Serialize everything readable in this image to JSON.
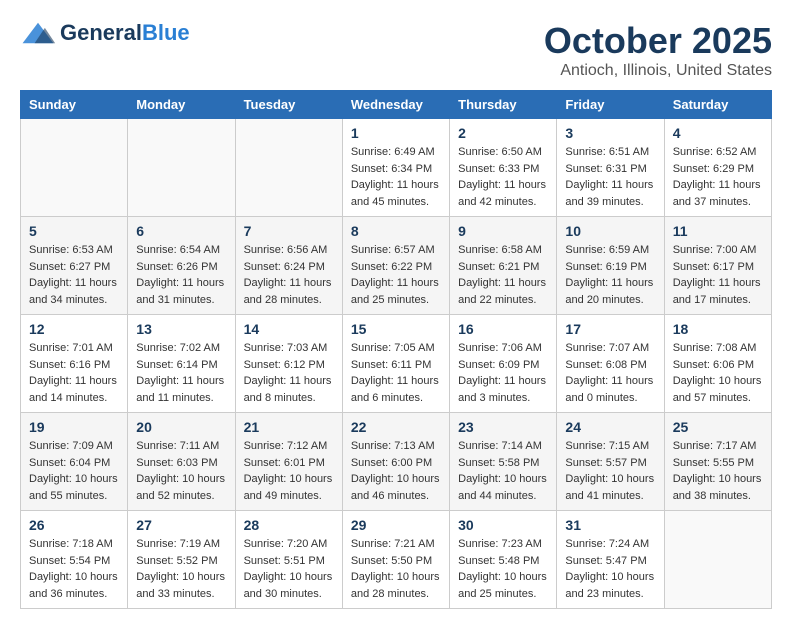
{
  "header": {
    "logo_general": "General",
    "logo_blue": "Blue",
    "month_title": "October 2025",
    "location": "Antioch, Illinois, United States"
  },
  "days_of_week": [
    "Sunday",
    "Monday",
    "Tuesday",
    "Wednesday",
    "Thursday",
    "Friday",
    "Saturday"
  ],
  "weeks": [
    [
      {
        "day": "",
        "info": ""
      },
      {
        "day": "",
        "info": ""
      },
      {
        "day": "",
        "info": ""
      },
      {
        "day": "1",
        "info": "Sunrise: 6:49 AM\nSunset: 6:34 PM\nDaylight: 11 hours\nand 45 minutes."
      },
      {
        "day": "2",
        "info": "Sunrise: 6:50 AM\nSunset: 6:33 PM\nDaylight: 11 hours\nand 42 minutes."
      },
      {
        "day": "3",
        "info": "Sunrise: 6:51 AM\nSunset: 6:31 PM\nDaylight: 11 hours\nand 39 minutes."
      },
      {
        "day": "4",
        "info": "Sunrise: 6:52 AM\nSunset: 6:29 PM\nDaylight: 11 hours\nand 37 minutes."
      }
    ],
    [
      {
        "day": "5",
        "info": "Sunrise: 6:53 AM\nSunset: 6:27 PM\nDaylight: 11 hours\nand 34 minutes."
      },
      {
        "day": "6",
        "info": "Sunrise: 6:54 AM\nSunset: 6:26 PM\nDaylight: 11 hours\nand 31 minutes."
      },
      {
        "day": "7",
        "info": "Sunrise: 6:56 AM\nSunset: 6:24 PM\nDaylight: 11 hours\nand 28 minutes."
      },
      {
        "day": "8",
        "info": "Sunrise: 6:57 AM\nSunset: 6:22 PM\nDaylight: 11 hours\nand 25 minutes."
      },
      {
        "day": "9",
        "info": "Sunrise: 6:58 AM\nSunset: 6:21 PM\nDaylight: 11 hours\nand 22 minutes."
      },
      {
        "day": "10",
        "info": "Sunrise: 6:59 AM\nSunset: 6:19 PM\nDaylight: 11 hours\nand 20 minutes."
      },
      {
        "day": "11",
        "info": "Sunrise: 7:00 AM\nSunset: 6:17 PM\nDaylight: 11 hours\nand 17 minutes."
      }
    ],
    [
      {
        "day": "12",
        "info": "Sunrise: 7:01 AM\nSunset: 6:16 PM\nDaylight: 11 hours\nand 14 minutes."
      },
      {
        "day": "13",
        "info": "Sunrise: 7:02 AM\nSunset: 6:14 PM\nDaylight: 11 hours\nand 11 minutes."
      },
      {
        "day": "14",
        "info": "Sunrise: 7:03 AM\nSunset: 6:12 PM\nDaylight: 11 hours\nand 8 minutes."
      },
      {
        "day": "15",
        "info": "Sunrise: 7:05 AM\nSunset: 6:11 PM\nDaylight: 11 hours\nand 6 minutes."
      },
      {
        "day": "16",
        "info": "Sunrise: 7:06 AM\nSunset: 6:09 PM\nDaylight: 11 hours\nand 3 minutes."
      },
      {
        "day": "17",
        "info": "Sunrise: 7:07 AM\nSunset: 6:08 PM\nDaylight: 11 hours\nand 0 minutes."
      },
      {
        "day": "18",
        "info": "Sunrise: 7:08 AM\nSunset: 6:06 PM\nDaylight: 10 hours\nand 57 minutes."
      }
    ],
    [
      {
        "day": "19",
        "info": "Sunrise: 7:09 AM\nSunset: 6:04 PM\nDaylight: 10 hours\nand 55 minutes."
      },
      {
        "day": "20",
        "info": "Sunrise: 7:11 AM\nSunset: 6:03 PM\nDaylight: 10 hours\nand 52 minutes."
      },
      {
        "day": "21",
        "info": "Sunrise: 7:12 AM\nSunset: 6:01 PM\nDaylight: 10 hours\nand 49 minutes."
      },
      {
        "day": "22",
        "info": "Sunrise: 7:13 AM\nSunset: 6:00 PM\nDaylight: 10 hours\nand 46 minutes."
      },
      {
        "day": "23",
        "info": "Sunrise: 7:14 AM\nSunset: 5:58 PM\nDaylight: 10 hours\nand 44 minutes."
      },
      {
        "day": "24",
        "info": "Sunrise: 7:15 AM\nSunset: 5:57 PM\nDaylight: 10 hours\nand 41 minutes."
      },
      {
        "day": "25",
        "info": "Sunrise: 7:17 AM\nSunset: 5:55 PM\nDaylight: 10 hours\nand 38 minutes."
      }
    ],
    [
      {
        "day": "26",
        "info": "Sunrise: 7:18 AM\nSunset: 5:54 PM\nDaylight: 10 hours\nand 36 minutes."
      },
      {
        "day": "27",
        "info": "Sunrise: 7:19 AM\nSunset: 5:52 PM\nDaylight: 10 hours\nand 33 minutes."
      },
      {
        "day": "28",
        "info": "Sunrise: 7:20 AM\nSunset: 5:51 PM\nDaylight: 10 hours\nand 30 minutes."
      },
      {
        "day": "29",
        "info": "Sunrise: 7:21 AM\nSunset: 5:50 PM\nDaylight: 10 hours\nand 28 minutes."
      },
      {
        "day": "30",
        "info": "Sunrise: 7:23 AM\nSunset: 5:48 PM\nDaylight: 10 hours\nand 25 minutes."
      },
      {
        "day": "31",
        "info": "Sunrise: 7:24 AM\nSunset: 5:47 PM\nDaylight: 10 hours\nand 23 minutes."
      },
      {
        "day": "",
        "info": ""
      }
    ]
  ]
}
